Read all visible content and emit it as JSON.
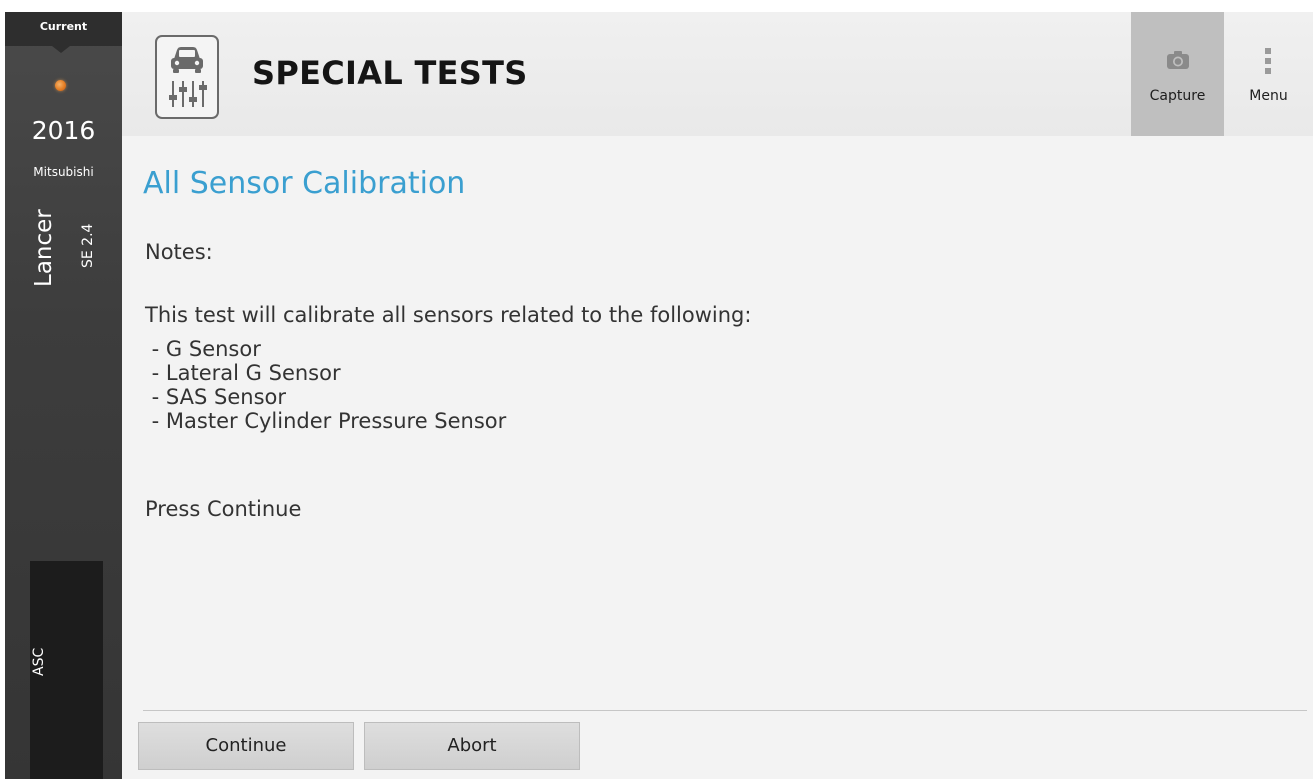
{
  "vehicle": {
    "current_label": "Current",
    "year": "2016",
    "make": "Mitsubishi",
    "model": "Lancer",
    "trim": "SE 2.4",
    "system": "ASC"
  },
  "header": {
    "title": "SPECIAL TESTS",
    "app_icon": "car-diagnostics-icon",
    "capture_label": "Capture",
    "capture_icon": "camera-icon",
    "menu_label": "Menu",
    "menu_icon": "vertical-dots-icon"
  },
  "test": {
    "title": "All Sensor Calibration",
    "notes_label": "Notes:",
    "description": "This test will calibrate all sensors related to the following:",
    "sensors": [
      " - G Sensor",
      " - Lateral G Sensor",
      " - SAS Sensor",
      " - Master Cylinder Pressure Sensor"
    ],
    "instruction": "Press Continue"
  },
  "actions": {
    "continue_label": "Continue",
    "abort_label": "Abort"
  },
  "colors": {
    "accent": "#3a9fd0",
    "sidebar": "#3d3d3d",
    "status_dot": "#e37d24"
  }
}
